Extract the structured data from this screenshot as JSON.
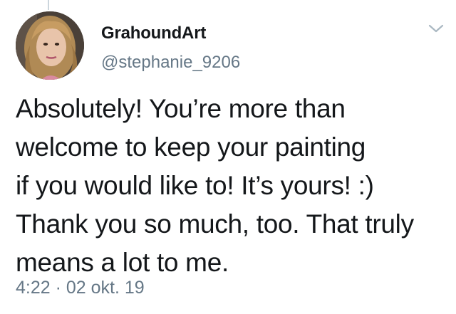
{
  "tweet": {
    "display_name": "GrahoundArt",
    "handle": "@stephanie_9206",
    "text_lines": [
      "Absolutely! You’re more than",
      "welcome to keep your painting",
      "if you would like to! It’s yours! :)",
      "Thank you so much, too. That truly",
      "means a lot to me."
    ],
    "time": "4:22",
    "separator": " · ",
    "date": "02 okt. 19"
  },
  "icons": {
    "menu": "chevron-down-icon",
    "avatar": "profile-photo"
  },
  "colors": {
    "text": "#14171a",
    "secondary": "#657786",
    "thread_line": "#ccd6dd",
    "caret": "#aab8c2"
  }
}
